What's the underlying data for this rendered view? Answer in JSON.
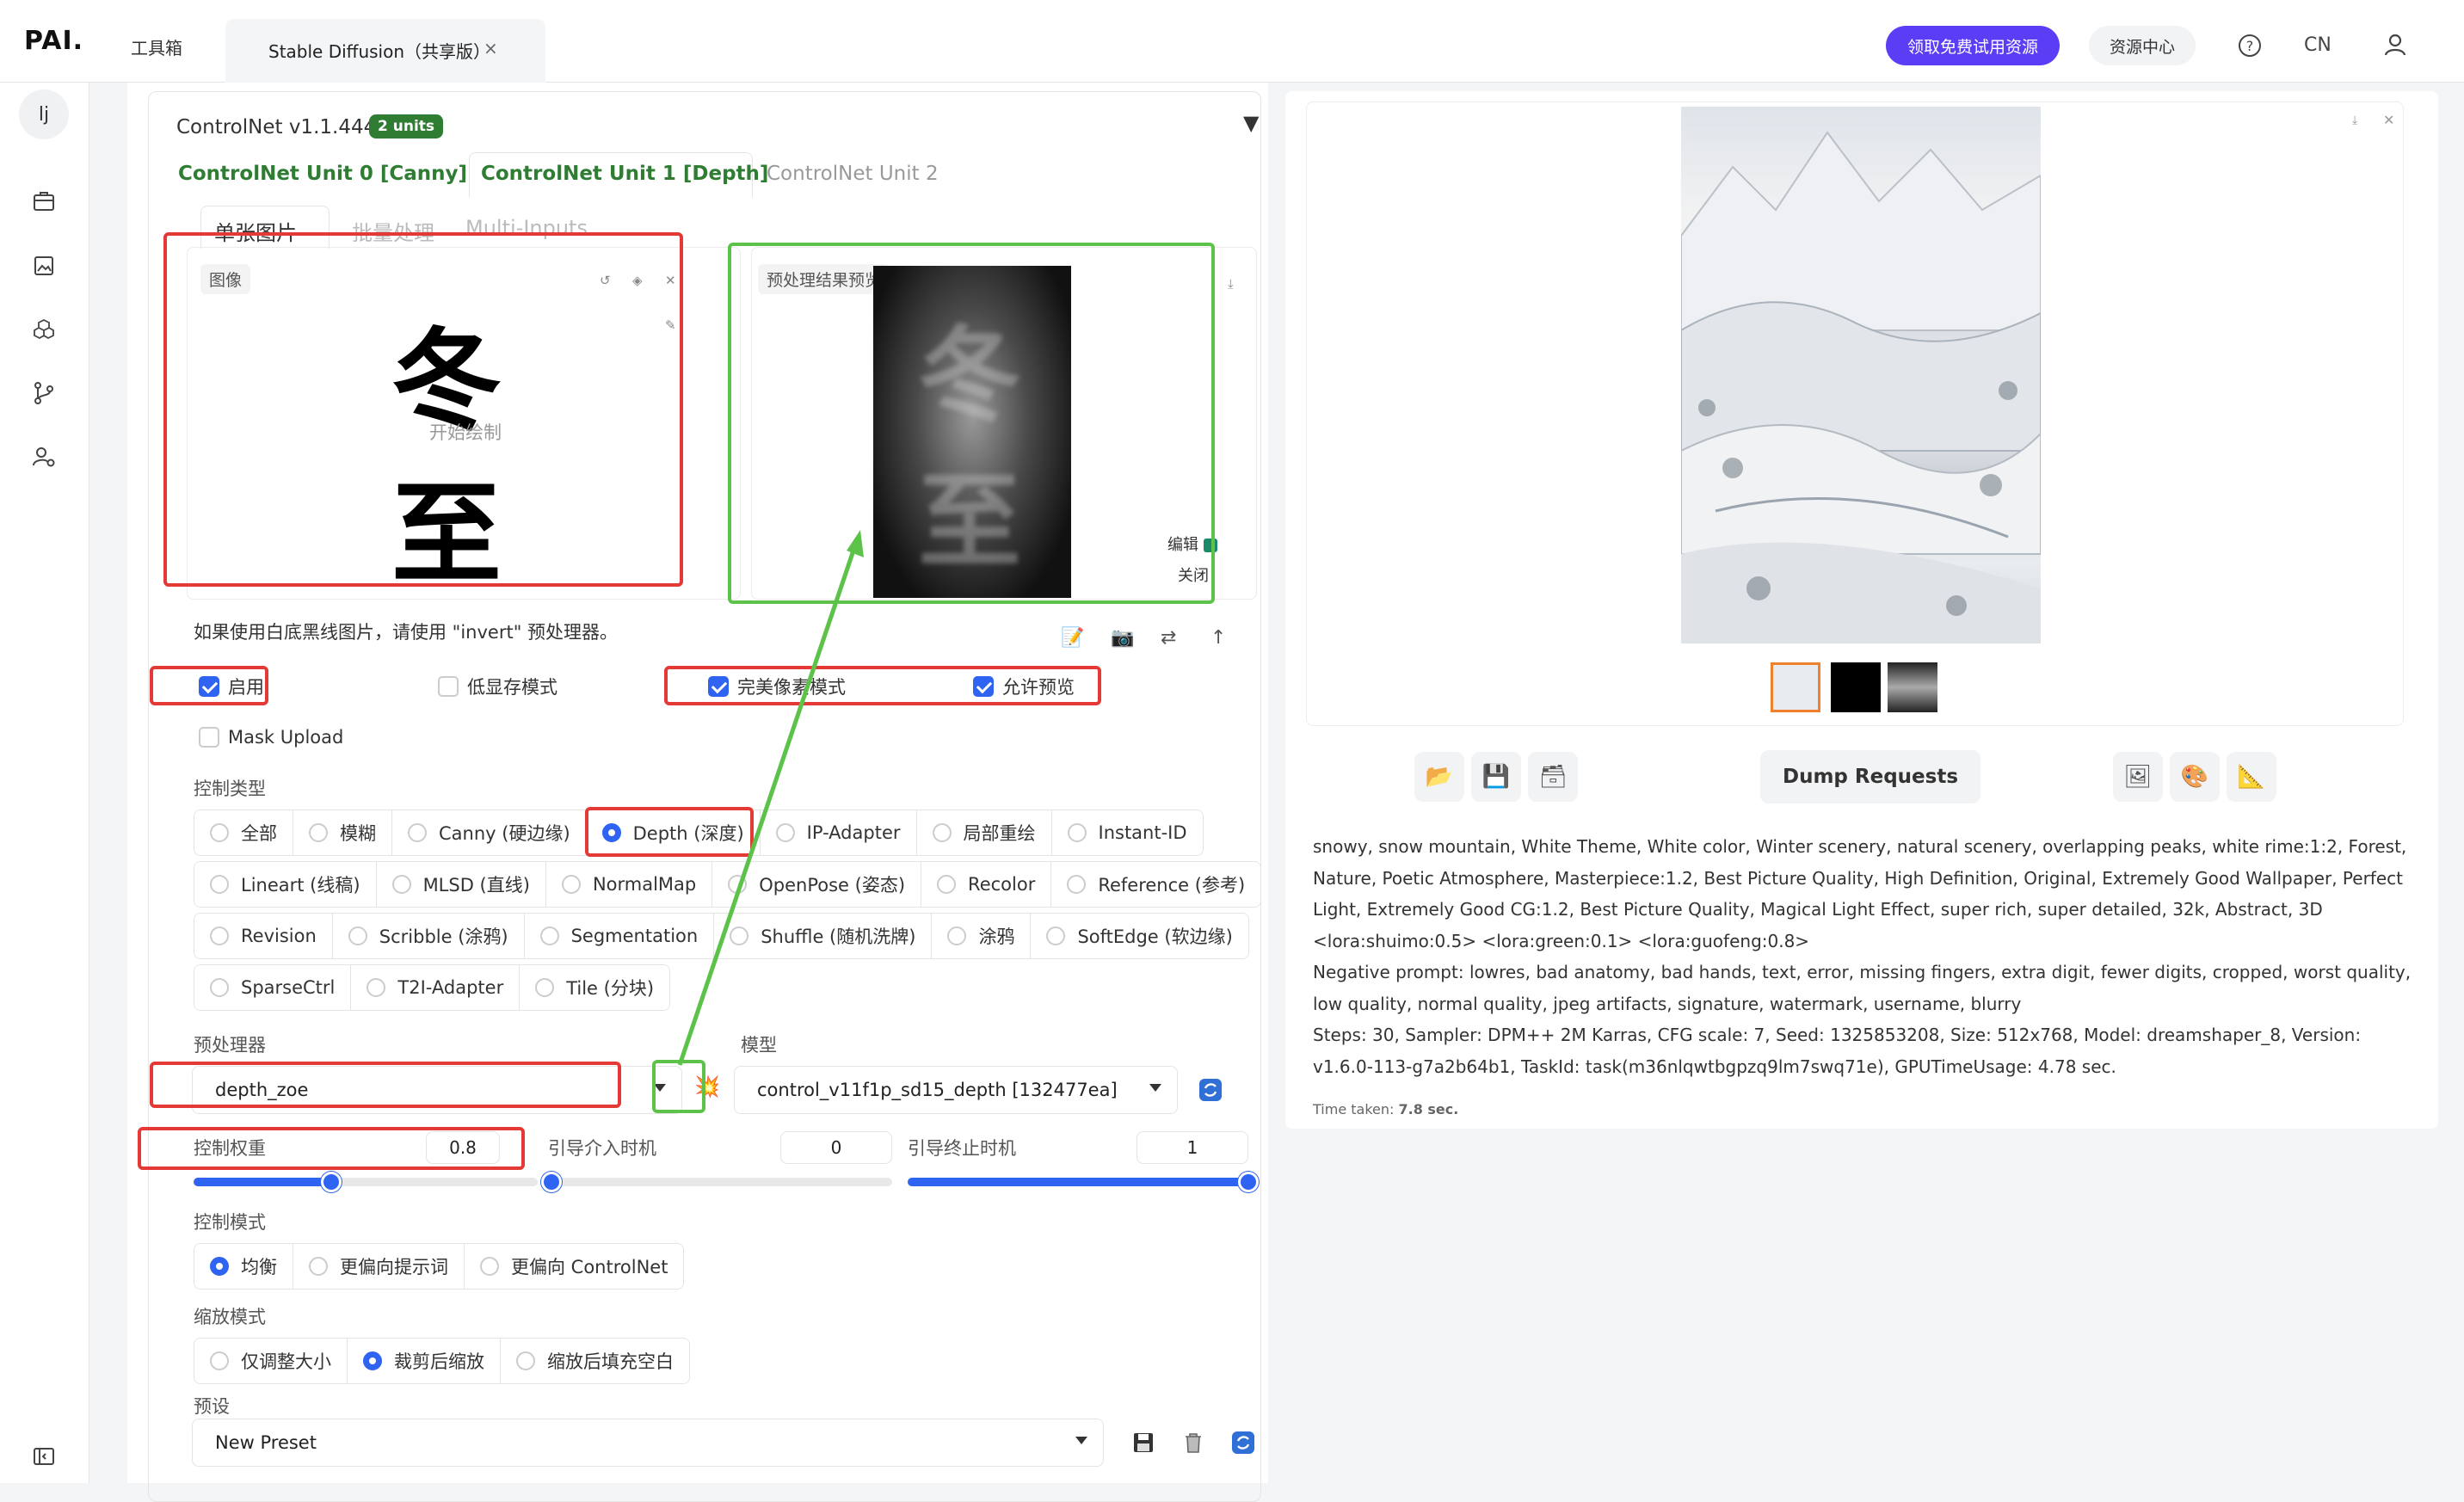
{
  "app": {
    "logo": "PAI.",
    "toolbox_tab": "工具箱",
    "active_tab": "Stable Diffusion（共享版）",
    "tab_close": "×",
    "promo_button": "领取免费试用资源",
    "resource_button": "资源中心",
    "help": "?",
    "language": "CN",
    "user_initial": "lj"
  },
  "controlnet": {
    "title": "ControlNet v1.1.444",
    "units_badge": "2 units",
    "collapse": "▼",
    "unit_tabs": [
      "ControlNet Unit 0 [Canny]",
      "ControlNet Unit 1 [Depth]",
      "ControlNet Unit 2"
    ],
    "input_tabs": [
      "单张图片",
      "批量处理",
      "Multi-Inputs"
    ],
    "image_label": "图像",
    "draw_hint": "开始绘制",
    "source_chars": [
      "冬",
      "至"
    ],
    "preview_label": "预处理结果预览",
    "preview_edit": "编辑",
    "preview_close": "关闭",
    "invert_hint": "如果使用白底黑线图片，请使用 \"invert\" 预处理器。",
    "checkboxes": {
      "enable": "启用",
      "low_vram": "低显存模式",
      "pixel_perfect": "完美像素模式",
      "allow_preview": "允许预览",
      "mask_upload": "Mask Upload"
    },
    "control_type_label": "控制类型",
    "control_types_row1": [
      "全部",
      "模糊",
      "Canny (硬边缘)",
      "Depth (深度)",
      "IP-Adapter",
      "局部重绘",
      "Instant-ID"
    ],
    "control_types_row2": [
      "Lineart (线稿)",
      "MLSD (直线)",
      "NormalMap",
      "OpenPose (姿态)",
      "Recolor",
      "Reference (参考)"
    ],
    "control_types_row3": [
      "Revision",
      "Scribble (涂鸦)",
      "Segmentation",
      "Shuffle (随机洗牌)",
      "涂鸦",
      "SoftEdge (软边缘)"
    ],
    "control_types_row4": [
      "SparseCtrl",
      "T2I-Adapter",
      "Tile (分块)"
    ],
    "preprocessor_label": "预处理器",
    "preprocessor_value": "depth_zoe",
    "model_label": "模型",
    "model_value": "control_v11f1p_sd15_depth [132477ea]",
    "weight_label": "控制权重",
    "weight_value": "0.8",
    "weight_fraction": 0.4,
    "start_label": "引导介入时机",
    "start_value": "0",
    "end_label": "引导终止时机",
    "end_value": "1",
    "control_mode_label": "控制模式",
    "control_modes": [
      "均衡",
      "更偏向提示词",
      "更偏向 ControlNet"
    ],
    "resize_mode_label": "缩放模式",
    "resize_modes": [
      "仅调整大小",
      "裁剪后缩放",
      "缩放后填充空白"
    ],
    "preset_label": "预设",
    "preset_value": "New Preset"
  },
  "output": {
    "dump_button": "Dump Requests",
    "prompt": "snowy, snow mountain, White Theme, White color, Winter scenery, natural scenery, overlapping peaks, white rime:1:2, Forest, Nature, Poetic Atmosphere, Masterpiece:1.2, Best Picture Quality, High Definition, Original, Extremely Good Wallpaper, Perfect Light, Extremely Good CG:1.2, Best Picture Quality, Magical Light Effect, super rich, super detailed, 32k, Abstract, 3D <lora:shuimo:0.5> <lora:green:0.1> <lora:guofeng:0.8>",
    "negative": "Negative prompt: lowres, bad anatomy, bad hands, text, error, missing fingers, extra digit, fewer digits, cropped, worst quality, low quality, normal quality, jpeg artifacts, signature, watermark, username, blurry",
    "params": "Steps: 30, Sampler: DPM++ 2M Karras, CFG scale: 7, Seed: 1325853208, Size: 512x768, Model: dreamshaper_8, Version: v1.6.0-113-g7a2b64b1, TaskId: task(m36nlqwtbgpzq9lm7swq71e), GPUTimeUsage: 4.78 sec.",
    "time_label": "Time taken:",
    "time_value": "7.8 sec."
  },
  "colors": {
    "accent": "#2f63f2",
    "brand": "#5a3df5",
    "active_green": "#2e7d32",
    "annotation_red": "#e53935",
    "annotation_green": "#5cc24a"
  }
}
